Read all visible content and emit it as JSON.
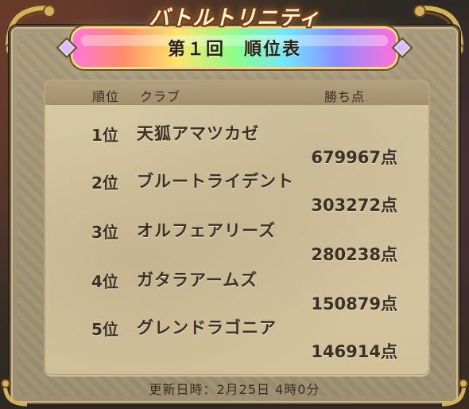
{
  "title": {
    "game": "バトルトリニティ",
    "board": "第１回　順位表"
  },
  "table": {
    "headers": {
      "rank": "順位",
      "club": "クラブ",
      "points": "勝ち点"
    },
    "rows": [
      {
        "rank": "1位",
        "club": "天狐アマツカゼ",
        "points": "679967点"
      },
      {
        "rank": "2位",
        "club": "ブルートライデント",
        "points": "303272点"
      },
      {
        "rank": "3位",
        "club": "オルフェアリーズ",
        "points": "280238点"
      },
      {
        "rank": "4位",
        "club": "ガタラアームズ",
        "points": "150879点"
      },
      {
        "rank": "5位",
        "club": "グレンドラゴニア",
        "points": "146914点"
      }
    ]
  },
  "footer": {
    "updated": "更新日時：2月25日 4時0分"
  },
  "colors": {
    "parchment": "#d6c8a4",
    "text_dark": "#3c2f24"
  }
}
